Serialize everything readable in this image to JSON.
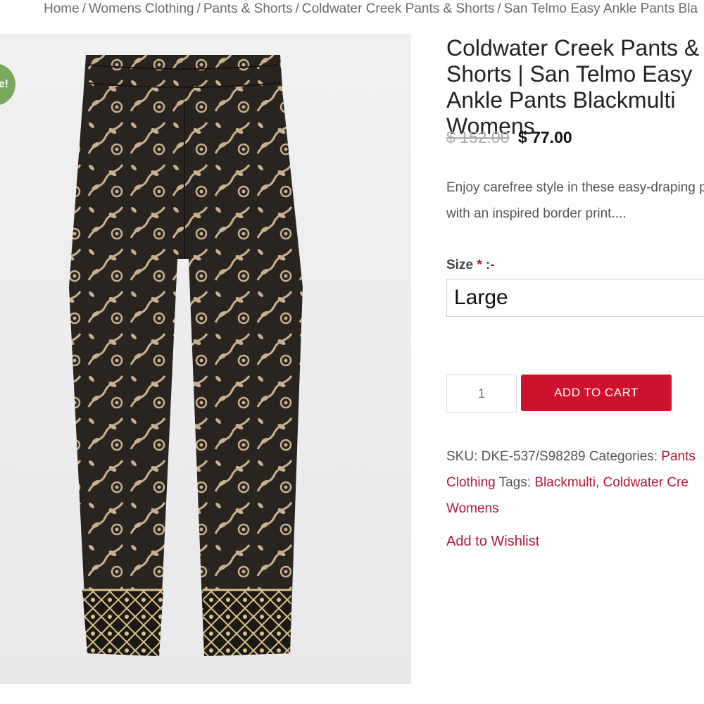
{
  "breadcrumb": {
    "items": [
      "Home",
      "Womens Clothing",
      "Pants & Shorts",
      "Coldwater Creek Pants & Shorts"
    ],
    "current": "San Telmo Easy Ankle Pants Bla"
  },
  "badge": {
    "label": "e!"
  },
  "product": {
    "title": "Coldwater Creek Pants & Shorts | San Telmo Easy Ankle Pants Blackmulti Womens",
    "old_price": "$ 152.00",
    "new_price": "$ 77.00",
    "description": "Enjoy carefree style in these easy-draping pants with an inspired border print....",
    "image_alt": "Black floral print ankle pants"
  },
  "size": {
    "label": "Size",
    "required_mark": "*",
    "suffix": " :-",
    "selected": "Large"
  },
  "cart": {
    "quantity": "1",
    "add_label": "ADD TO CART"
  },
  "meta": {
    "sku_label": "SKU:",
    "sku": "DKE-537/S98289",
    "categories_label": "Categories:",
    "categories": [
      "Pants",
      "Clothing"
    ],
    "tags_label": "Tags:",
    "tags": [
      "Blackmulti",
      "Coldwater Cre",
      "Womens"
    ]
  },
  "wishlist": {
    "label": "Add to Wishlist"
  },
  "colors": {
    "accent": "#d0112b",
    "link": "#b01a33",
    "badge": "#7aa85c"
  }
}
